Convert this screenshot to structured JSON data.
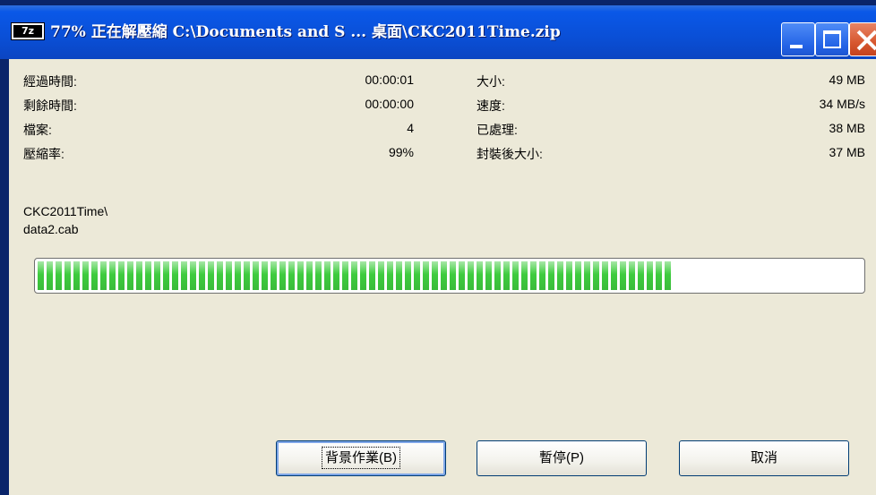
{
  "window": {
    "title": "77% 正在解壓縮 C:\\Documents and S ... 桌面\\CKC2011Time.zip",
    "icon_label": "7z",
    "icon": "7zip-app-icon"
  },
  "stats_left": [
    {
      "label": "經過時間:",
      "value": "00:00:01"
    },
    {
      "label": "剩餘時間:",
      "value": "00:00:00"
    },
    {
      "label": "檔案:",
      "value": "4"
    },
    {
      "label": "壓縮率:",
      "value": "99%"
    }
  ],
  "stats_right": [
    {
      "label": "大小:",
      "value": "49 MB"
    },
    {
      "label": "速度:",
      "value": "34 MB/s"
    },
    {
      "label": "已處理:",
      "value": "38 MB"
    },
    {
      "label": "封裝後大小:",
      "value": "37 MB"
    }
  ],
  "current": {
    "folder": "CKC2011Time\\",
    "file": "data2.cab"
  },
  "progress": {
    "percent": 77,
    "color": "#3fcc3f"
  },
  "buttons": {
    "background": "背景作業(B)",
    "pause": "暫停(P)",
    "cancel": "取消"
  }
}
